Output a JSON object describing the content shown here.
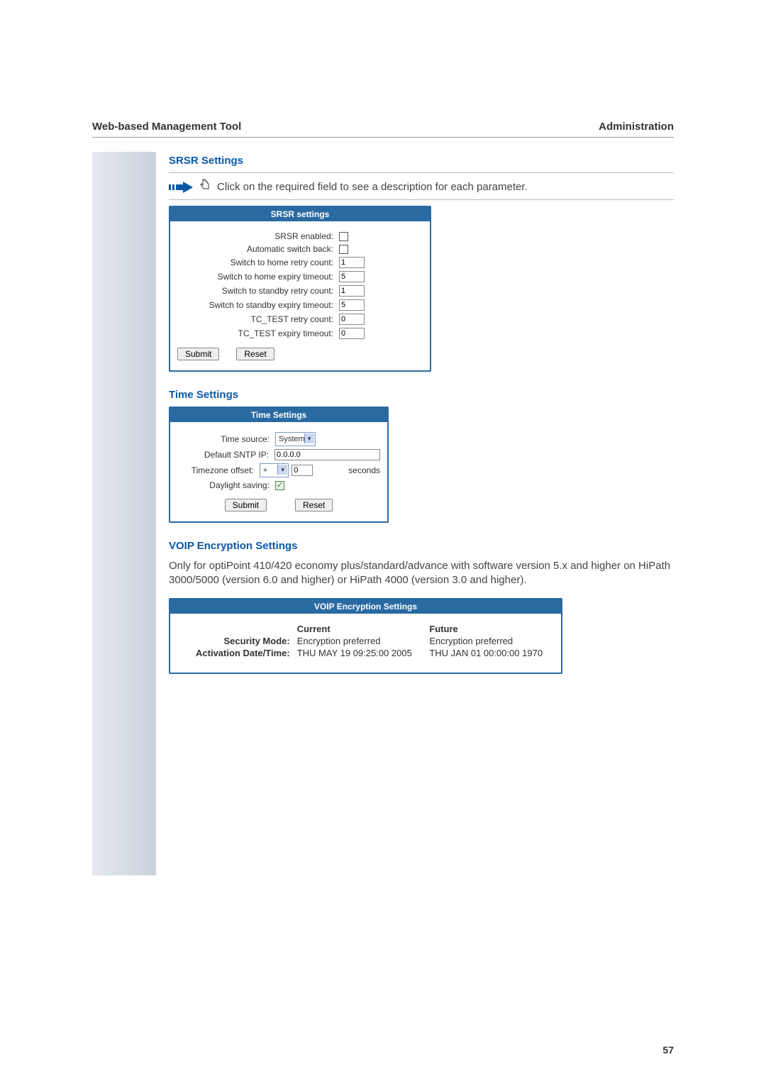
{
  "header": {
    "left": "Web-based Management Tool",
    "right": "Administration"
  },
  "page_number": "57",
  "srsr": {
    "title": "SRSR Settings",
    "note": "Click on the required field to see a description for each parameter.",
    "panel_title": "SRSR settings",
    "fields": {
      "enabled_label": "SRSR enabled:",
      "auto_switch_label": "Automatic switch back:",
      "home_retry_label": "Switch to home retry count:",
      "home_retry_value": "1",
      "home_expiry_label": "Switch to home expiry timeout:",
      "home_expiry_value": "5",
      "standby_retry_label": "Switch to standby retry count:",
      "standby_retry_value": "1",
      "standby_expiry_label": "Switch to standby expiry timeout:",
      "standby_expiry_value": "5",
      "tctest_retry_label": "TC_TEST retry count:",
      "tctest_retry_value": "0",
      "tctest_expiry_label": "TC_TEST expiry timeout:",
      "tctest_expiry_value": "0"
    },
    "submit": "Submit",
    "reset": "Reset"
  },
  "time": {
    "title": "Time Settings",
    "panel_title": "Time Settings",
    "source_label": "Time source:",
    "source_value": "System",
    "sntp_label": "Default SNTP IP:",
    "sntp_value": "0.0.0.0",
    "tz_label": "Timezone offset:",
    "tz_sign": "+",
    "tz_value": "0",
    "tz_unit": "seconds",
    "daylight_label": "Daylight saving:",
    "submit": "Submit",
    "reset": "Reset"
  },
  "voip": {
    "title": "VOIP Encryption Settings",
    "paragraph": "Only for optiPoint 410/420 economy plus/standard/advance with software version 5.x and higher on HiPath 3000/5000 (version 6.0 and higher) or HiPath 4000 (version 3.0 and higher).",
    "panel_title": "VOIP Encryption Settings",
    "col_current": "Current",
    "col_future": "Future",
    "security_label": "Security Mode:",
    "security_current": "Encryption preferred",
    "security_future": "Encryption preferred",
    "activation_label": "Activation Date/Time:",
    "activation_current": "THU MAY 19 09:25:00 2005",
    "activation_future": "THU JAN 01 00:00:00 1970"
  }
}
